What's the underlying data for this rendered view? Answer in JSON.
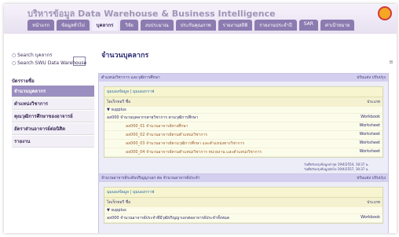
{
  "header": {
    "title": "บริหารข้อมูล Data Warehouse & Business Intelligence",
    "tabs": [
      {
        "label": "หน้าแรก"
      },
      {
        "label": "ข้อมูลทั่วไป"
      },
      {
        "label": "บุคลากร"
      },
      {
        "label": "วิจัย"
      },
      {
        "label": "งบประมาณ"
      },
      {
        "label": "ประกันคุณภาพ"
      },
      {
        "label": "รายงานสถิติ"
      },
      {
        "label": "รายงานประจำปี"
      },
      {
        "label": "SAR"
      },
      {
        "label": "ค่าเป้าหมาย"
      }
    ],
    "active_tab": "บุคลากร"
  },
  "sidebar": {
    "search_options": [
      "Search บุคลากร",
      "Search SWU Data Warehouse"
    ],
    "heading": "บัตรรายชื่อ",
    "items": [
      {
        "label": "จำนวนบุคลากร"
      },
      {
        "label": "ตำแหน่งวิชาการ"
      },
      {
        "label": "คุณวุฒิการศึกษาของอาจารย์"
      },
      {
        "label": "อัตราส่วนอาจารย์ต่อนิสิต"
      },
      {
        "label": "รายงาน"
      }
    ]
  },
  "main": {
    "title": "จำนวนบุคลากร",
    "panel1": {
      "title": "ตำแหน่งวิชาการ และวุฒิการศึกษา",
      "actions": "ปรับแต่ง ปรับปรุง",
      "tab": "มุมมองข้อมูล | มุมมองกราฟ",
      "col_name": "ไดเร็กทอรี ชื่อ",
      "col_type": "ประเภท",
      "folder": "supplus",
      "rows": [
        {
          "name": "ax000 จำนวนบุคลากรสายวิชาการ ตามวุฒิการศึกษา",
          "type": "Workbook"
        },
        {
          "name": "ax000_01 จำนวนอาจารย์ทางศึกษา",
          "type": "Worksheet"
        },
        {
          "name": "ax000_02 จำนวนอาจารย์ตามตำแหน่งวิชาการ",
          "type": "Worksheet"
        },
        {
          "name": "ax000_03 จำนวนอาจารย์ตามวุฒิการศึกษา และตำแหน่งทางวิชาการ",
          "type": "Worksheet"
        },
        {
          "name": "ax000_04 จำนวนอาจารย์ตามตำแหน่งวิชาการ หน่วยงาน และตำแหน่งวิชาการ",
          "type": "Worksheet"
        }
      ],
      "meta_line1": "วันที่ปรับปรุงข้อมูลล่าสุด 19/4/2554, 18:37 น.",
      "meta_line2": "วันที่ปรับปรุงข้อมูลถัดไป 19/4/2557, 18:37 น."
    },
    "panel2": {
      "title": "จำนวนอาจารย์ระดับปริญญาเอก ต่อ จำนวนอาจารย์ประจำ",
      "actions": "ปรับแต่ง ปรับปรุง",
      "tab": "มุมมองข้อมูล | มุมมองกราฟ",
      "col_name": "ไดเร็กทอรี ชื่อ",
      "col_type": "ประเภท",
      "folder": "supplus",
      "rows": [
        {
          "name": "ax000 จำนวนอาจารย์ประจำที่มีวุฒิปริญญาเอกต่ออาจารย์ประจำทั้งหมด",
          "type": "Workbook"
        }
      ]
    }
  }
}
